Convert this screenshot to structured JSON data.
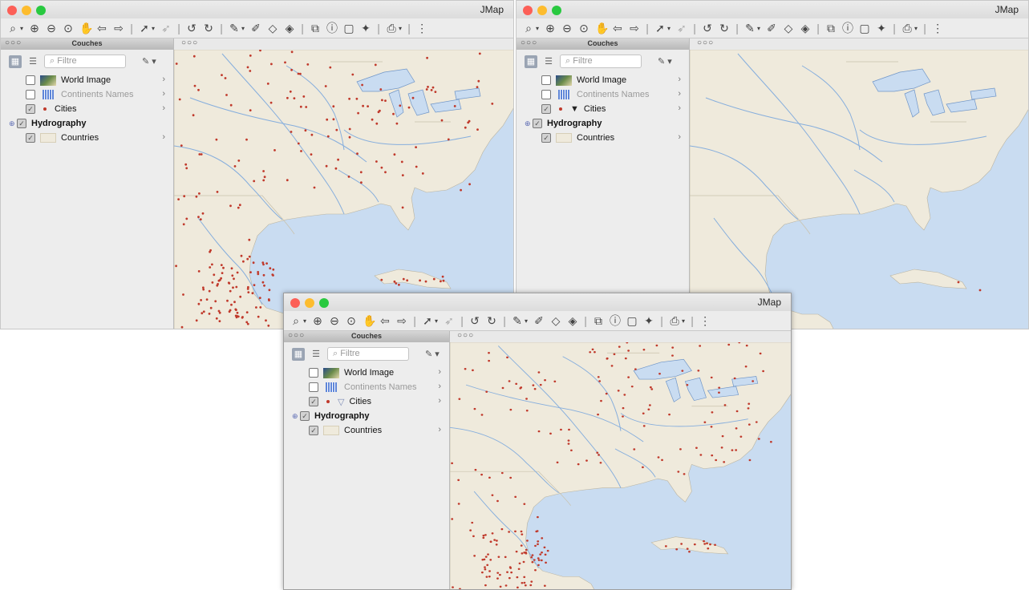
{
  "app": {
    "title": "JMap"
  },
  "toolbar": {
    "icons": [
      "zoom-select-icon",
      "dropdown-arrow",
      "zoom-in-icon",
      "zoom-out-icon",
      "zoom-extent-icon",
      "pan-hand-icon",
      "back-arrow-icon",
      "forward-arrow-icon",
      "sep",
      "select-tool-icon",
      "dropdown-arrow",
      "select-tool-alt-icon",
      "sep",
      "undo-icon",
      "redo-icon",
      "sep",
      "measure-icon",
      "dropdown-arrow",
      "measure-area-icon",
      "tag-icon",
      "tag-search-icon",
      "sep",
      "layout-icon",
      "info-icon",
      "document-icon",
      "tool-icon",
      "sep",
      "print-icon",
      "dropdown-arrow",
      "sep",
      "more-icon"
    ]
  },
  "panel": {
    "header": "Couches",
    "filter_placeholder": "Filtre"
  },
  "windows": [
    {
      "layers": [
        {
          "name": "World Image",
          "checked": false,
          "icon": "world-image-icon",
          "dim": false,
          "bold": false,
          "has_chevron": true,
          "top": false,
          "funnel": "none"
        },
        {
          "name": "Continents Names",
          "checked": false,
          "icon": "grid-icon",
          "dim": true,
          "bold": false,
          "has_chevron": true,
          "top": false,
          "funnel": "none"
        },
        {
          "name": "Cities",
          "checked": true,
          "icon": "point-icon",
          "dim": false,
          "bold": false,
          "has_chevron": true,
          "top": false,
          "funnel": "none"
        },
        {
          "name": "Hydrography",
          "checked": true,
          "icon": "none",
          "dim": false,
          "bold": true,
          "has_chevron": false,
          "top": true,
          "funnel": "none"
        },
        {
          "name": "Countries",
          "checked": true,
          "icon": "polygon-icon",
          "dim": false,
          "bold": false,
          "has_chevron": true,
          "top": false,
          "funnel": "none"
        }
      ],
      "cities_visible": true
    },
    {
      "layers": [
        {
          "name": "World Image",
          "checked": false,
          "icon": "world-image-icon",
          "dim": false,
          "bold": false,
          "has_chevron": true,
          "top": false,
          "funnel": "none"
        },
        {
          "name": "Continents Names",
          "checked": false,
          "icon": "grid-icon",
          "dim": true,
          "bold": false,
          "has_chevron": true,
          "top": false,
          "funnel": "none"
        },
        {
          "name": "Cities",
          "checked": true,
          "icon": "point-icon",
          "dim": false,
          "bold": false,
          "has_chevron": true,
          "top": false,
          "funnel": "dark"
        },
        {
          "name": "Hydrography",
          "checked": true,
          "icon": "none",
          "dim": false,
          "bold": true,
          "has_chevron": false,
          "top": true,
          "funnel": "none"
        },
        {
          "name": "Countries",
          "checked": true,
          "icon": "polygon-icon",
          "dim": false,
          "bold": false,
          "has_chevron": true,
          "top": false,
          "funnel": "none"
        }
      ],
      "cities_visible": false
    },
    {
      "layers": [
        {
          "name": "World Image",
          "checked": false,
          "icon": "world-image-icon",
          "dim": false,
          "bold": false,
          "has_chevron": true,
          "top": false,
          "funnel": "none"
        },
        {
          "name": "Continents Names",
          "checked": false,
          "icon": "grid-icon",
          "dim": true,
          "bold": false,
          "has_chevron": true,
          "top": false,
          "funnel": "none"
        },
        {
          "name": "Cities",
          "checked": true,
          "icon": "point-icon",
          "dim": false,
          "bold": false,
          "has_chevron": true,
          "top": false,
          "funnel": "light"
        },
        {
          "name": "Hydrography",
          "checked": true,
          "icon": "none",
          "dim": false,
          "bold": true,
          "has_chevron": false,
          "top": true,
          "funnel": "none"
        },
        {
          "name": "Countries",
          "checked": true,
          "icon": "polygon-icon",
          "dim": false,
          "bold": false,
          "has_chevron": true,
          "top": false,
          "funnel": "none"
        }
      ],
      "cities_visible": true
    }
  ],
  "colors": {
    "water": "#c9dcf1",
    "land": "#efeadc",
    "river": "#86aedd",
    "city": "#c0392b"
  }
}
